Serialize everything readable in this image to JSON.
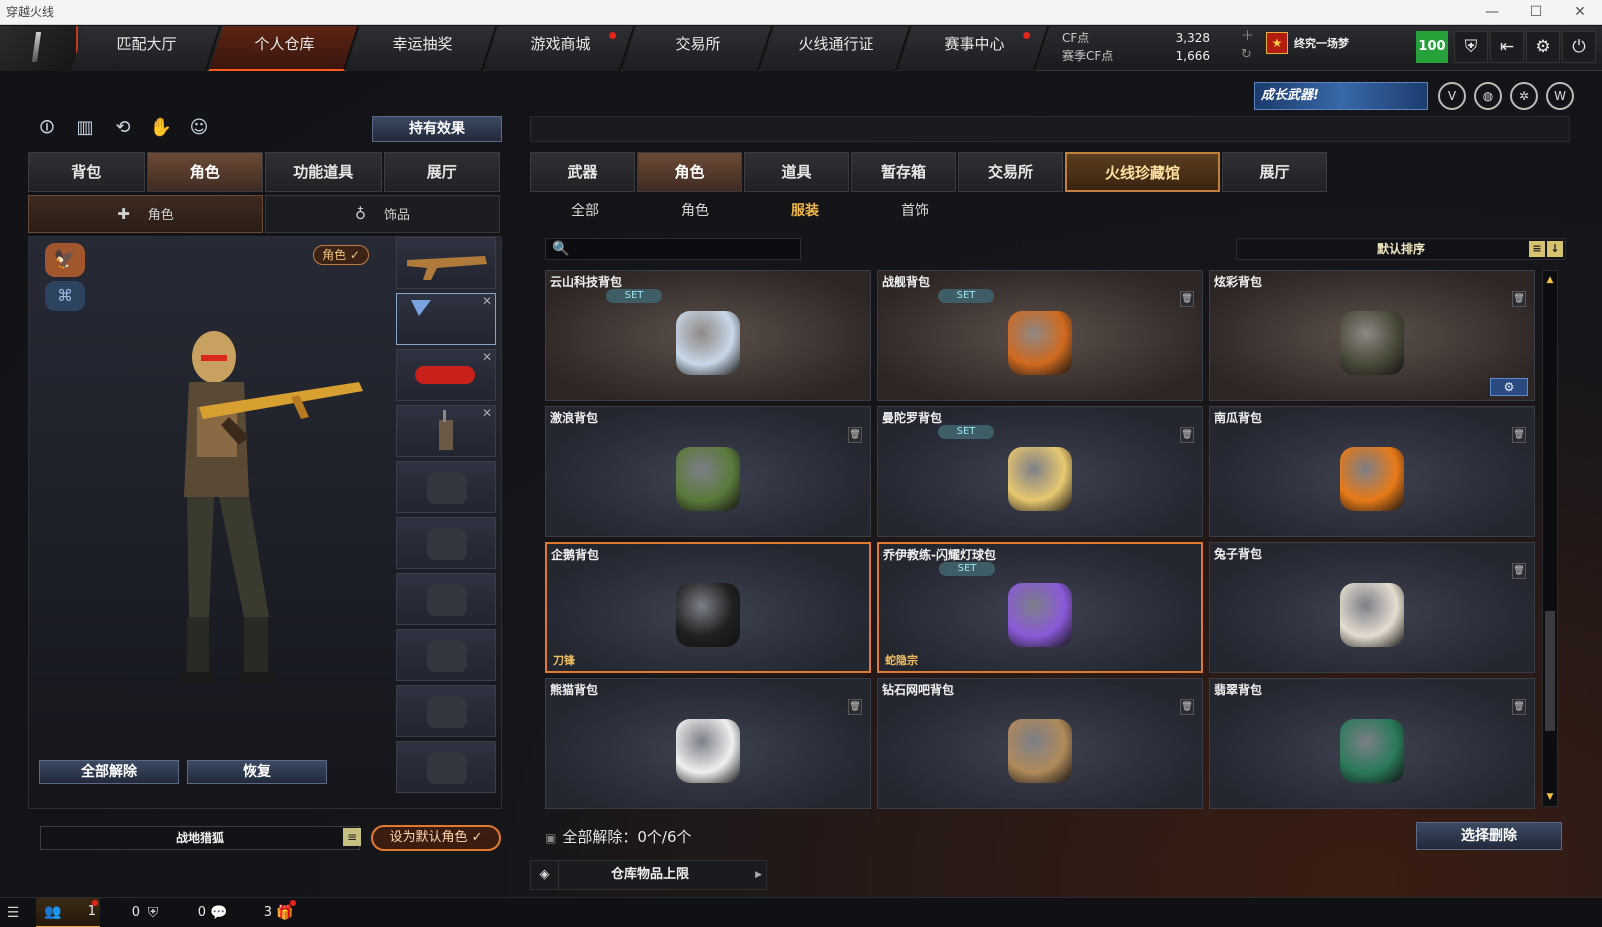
{
  "window": {
    "title": "穿越火线"
  },
  "nav": {
    "tabs": [
      {
        "label": "匹配大厅",
        "active": false,
        "dot": false
      },
      {
        "label": "个人仓库",
        "active": true,
        "dot": false
      },
      {
        "label": "幸运抽奖",
        "active": false,
        "dot": false
      },
      {
        "label": "游戏商城",
        "active": false,
        "dot": true
      },
      {
        "label": "交易所",
        "active": false,
        "dot": false
      },
      {
        "label": "火线通行证",
        "active": false,
        "dot": false
      },
      {
        "label": "赛事中心",
        "active": false,
        "dot": true
      }
    ]
  },
  "currency": {
    "cf_label": "CF点",
    "cf_value": "3,328",
    "season_label": "赛季CF点",
    "season_value": "1,666"
  },
  "player": {
    "rank_name": "终究一场梦",
    "level": "100"
  },
  "top_icons": [
    "shield-icon",
    "exit-door-icon",
    "gear-icon",
    "power-icon"
  ],
  "banner": {
    "text": "成长武器!"
  },
  "left": {
    "effect_button": "持有效果",
    "tabs": [
      {
        "label": "背包",
        "active": false
      },
      {
        "label": "角色",
        "active": true
      },
      {
        "label": "功能道具",
        "active": false
      },
      {
        "label": "展厅",
        "active": false
      }
    ],
    "subtabs": [
      {
        "label": "角色",
        "active": true
      },
      {
        "label": "饰品",
        "active": false
      }
    ],
    "char_badge": "角色 ✓",
    "release_all": "全部解除",
    "restore": "恢复",
    "character_name": "战地猎狐",
    "set_default": "设为默认角色 ✓"
  },
  "right": {
    "tabs": [
      {
        "label": "武器",
        "active": false
      },
      {
        "label": "角色",
        "active": true
      },
      {
        "label": "道具",
        "active": false
      },
      {
        "label": "暂存箱",
        "active": false
      },
      {
        "label": "交易所",
        "active": false
      },
      {
        "label": "火线珍藏馆",
        "active": false
      },
      {
        "label": "展厅",
        "active": false
      }
    ],
    "subtabs": [
      {
        "label": "全部",
        "active": false
      },
      {
        "label": "角色",
        "active": false
      },
      {
        "label": "服装",
        "active": true
      },
      {
        "label": "首饰",
        "active": false
      }
    ],
    "search_placeholder": "",
    "sort_label": "默认排序",
    "items": [
      {
        "name": "云山科技背包",
        "set": "SET",
        "trash": false,
        "owner": "",
        "selected": false,
        "gear": false,
        "color": "#c8d8e8",
        "warm": true
      },
      {
        "name": "战舰背包",
        "set": "SET",
        "trash": true,
        "owner": "",
        "selected": false,
        "gear": false,
        "color": "#d06a20",
        "warm": true
      },
      {
        "name": "炫彩背包",
        "set": "",
        "trash": true,
        "owner": "",
        "selected": false,
        "gear": true,
        "color": "#4a4a3a",
        "warm": true
      },
      {
        "name": "激浪背包",
        "set": "",
        "trash": true,
        "owner": "",
        "selected": false,
        "gear": false,
        "color": "#5a7a3a",
        "warm": false
      },
      {
        "name": "曼陀罗背包",
        "set": "SET",
        "trash": true,
        "owner": "",
        "selected": false,
        "gear": false,
        "color": "#e8c870",
        "warm": false
      },
      {
        "name": "南瓜背包",
        "set": "",
        "trash": true,
        "owner": "",
        "selected": false,
        "gear": false,
        "color": "#e87a18",
        "warm": false
      },
      {
        "name": "企鹅背包",
        "set": "",
        "trash": false,
        "owner": "刀锋",
        "selected": true,
        "gear": false,
        "color": "#202020",
        "warm": false
      },
      {
        "name": "乔伊教练-闪耀灯球包",
        "set": "SET",
        "trash": false,
        "owner": "蛇隐宗",
        "selected": true,
        "gear": false,
        "color": "#8a5ad8",
        "warm": false
      },
      {
        "name": "兔子背包",
        "set": "",
        "trash": true,
        "owner": "",
        "selected": false,
        "gear": false,
        "color": "#e6ddd0",
        "warm": false
      },
      {
        "name": "熊猫背包",
        "set": "",
        "trash": true,
        "owner": "",
        "selected": false,
        "gear": false,
        "color": "#f0f0f0",
        "warm": false
      },
      {
        "name": "钻石网吧背包",
        "set": "",
        "trash": true,
        "owner": "",
        "selected": false,
        "gear": false,
        "color": "#b08a5a",
        "warm": false
      },
      {
        "name": "翡翠背包",
        "set": "",
        "trash": true,
        "owner": "",
        "selected": false,
        "gear": false,
        "color": "#2a7a5a",
        "warm": false
      }
    ],
    "release_info": "全部解除：0个/6个",
    "choose_delete": "选择删除",
    "storage_limit": "仓库物品上限"
  },
  "bottom": {
    "counts": [
      {
        "icon": "list-icon",
        "value": "",
        "dot": false
      },
      {
        "icon": "users-icon",
        "value": "1",
        "dot": true
      },
      {
        "icon": "clan-shield-icon",
        "value": "0",
        "dot": false
      },
      {
        "icon": "chat-bubble-icon",
        "value": "0",
        "dot": false
      },
      {
        "icon": "gift-icon",
        "value": "3",
        "dot": true
      }
    ]
  }
}
